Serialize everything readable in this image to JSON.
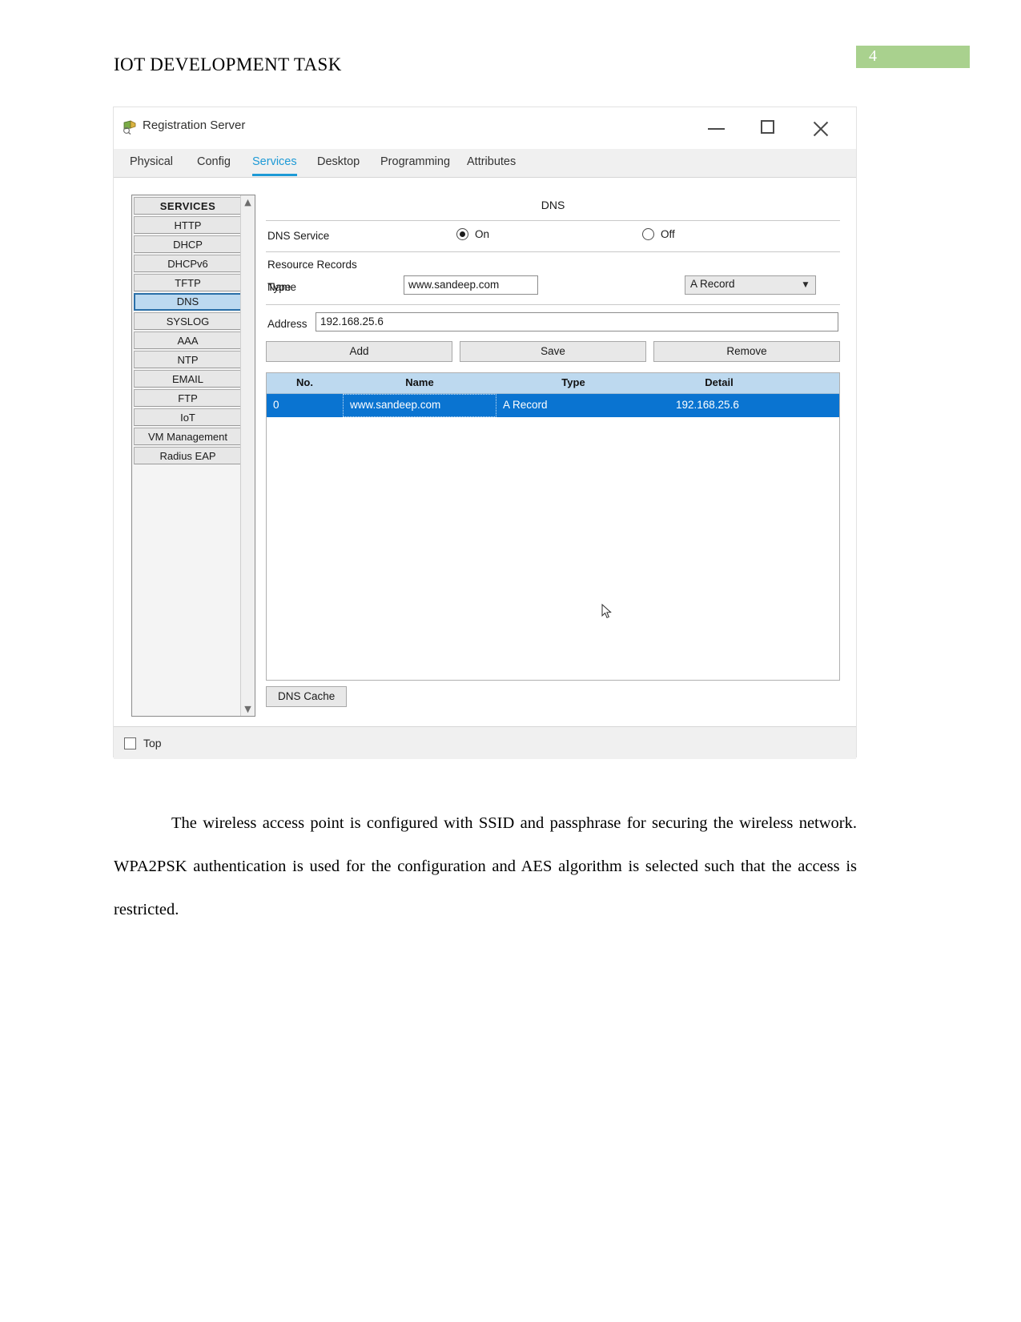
{
  "document": {
    "heading": "IOT DEVELOPMENT TASK",
    "page_number": "4",
    "page_badge_color": "#a9d18e",
    "paragraph": "The wireless access point is configured with SSID and passphrase for securing the wireless network. WPA2PSK authentication is used for the configuration and AES algorithm is selected such that the access is restricted."
  },
  "window": {
    "title": "Registration Server",
    "icon": "packet-tracer-device-icon",
    "controls": {
      "minimize": "minimize-icon",
      "maximize": "maximize-icon",
      "close": "close-icon"
    }
  },
  "tabs": [
    {
      "label": "Physical",
      "active": false
    },
    {
      "label": "Config",
      "active": false
    },
    {
      "label": "Services",
      "active": true
    },
    {
      "label": "Desktop",
      "active": false
    },
    {
      "label": "Programming",
      "active": false
    },
    {
      "label": "Attributes",
      "active": false
    }
  ],
  "tab_accent_color": "#1e9ad6",
  "sidebar": {
    "header": "SERVICES",
    "selected": "DNS",
    "items": [
      "HTTP",
      "DHCP",
      "DHCPv6",
      "TFTP",
      "DNS",
      "SYSLOG",
      "AAA",
      "NTP",
      "EMAIL",
      "FTP",
      "IoT",
      "VM Management",
      "Radius EAP"
    ],
    "scroll_up_icon": "chevron-up-icon",
    "scroll_down_icon": "chevron-down-icon"
  },
  "panel": {
    "title": "DNS",
    "service_label": "DNS Service",
    "radio_on_label": "On",
    "radio_off_label": "Off",
    "service_state": "On",
    "resource_records_label": "Resource Records",
    "name_label": "Name",
    "name_value": "www.sandeep.com",
    "type_label": "Type",
    "type_value": "A Record",
    "address_label": "Address",
    "address_value": "192.168.25.6",
    "buttons": {
      "add": "Add",
      "save": "Save",
      "remove": "Remove"
    },
    "table": {
      "columns": [
        "No.",
        "Name",
        "Type",
        "Detail"
      ],
      "rows": [
        {
          "no": "0",
          "name": "www.sandeep.com",
          "type": "A Record",
          "detail": "192.168.25.6",
          "selected": true
        }
      ],
      "header_color": "#bdd9ef",
      "selected_row_color": "#0a74d1"
    },
    "dns_cache_button": "DNS Cache"
  },
  "bottom_bar": {
    "top_checkbox_label": "Top",
    "top_checkbox_checked": false
  },
  "pointer": {
    "icon": "mouse-cursor-icon"
  }
}
